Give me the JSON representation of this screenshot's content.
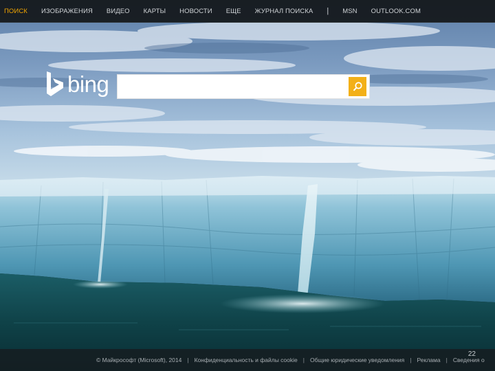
{
  "nav": {
    "items": [
      {
        "label": "ПОИСК",
        "active": true
      },
      {
        "label": "ИЗОБРАЖЕНИЯ",
        "active": false
      },
      {
        "label": "ВИДЕО",
        "active": false
      },
      {
        "label": "КАРТЫ",
        "active": false
      },
      {
        "label": "НОВОСТИ",
        "active": false
      },
      {
        "label": "ЕЩЕ",
        "active": false
      },
      {
        "label": "ЖУРНАЛ ПОИСКА",
        "active": false
      }
    ],
    "separator": "|",
    "extra": [
      {
        "label": "MSN"
      },
      {
        "label": "OUTLOOK.COM"
      }
    ]
  },
  "logo": {
    "wordmark": "bing",
    "icon": "bing-b-icon"
  },
  "search": {
    "value": "",
    "button_icon": "search-icon"
  },
  "footer": {
    "copyright": "© Майкрософт (Microsoft), 2014",
    "links": [
      "Конфиденциальность и файлы cookie",
      "Общие юридические уведомления",
      "Реклама",
      "Сведения о"
    ]
  },
  "page_number": "22",
  "colors": {
    "accent": "#f1a500",
    "search_button": "#f3b018",
    "nav_text": "#cfd3d6",
    "topbar_bg": "#121618"
  }
}
